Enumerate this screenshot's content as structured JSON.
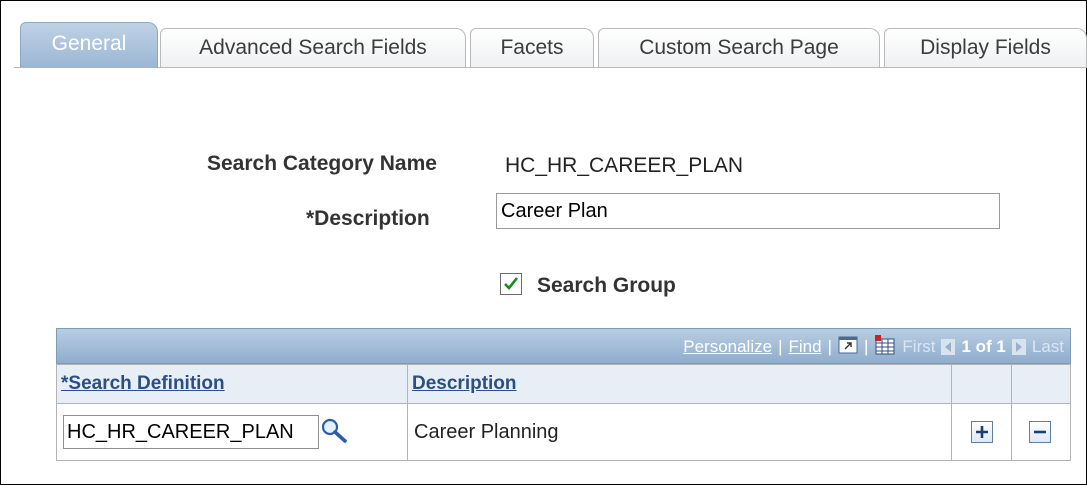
{
  "tabs": [
    {
      "label": "General",
      "active": true
    },
    {
      "label": "Advanced Search Fields",
      "active": false
    },
    {
      "label": "Facets",
      "active": false
    },
    {
      "label": "Custom Search Page",
      "active": false
    },
    {
      "label": "Display Fields",
      "active": false
    }
  ],
  "form": {
    "category_label": "Search Category Name",
    "category_value": "HC_HR_CAREER_PLAN",
    "description_label": "*Description",
    "description_value": "Career Plan",
    "search_group_label": "Search Group",
    "search_group_checked": true
  },
  "grid": {
    "personalize": "Personalize",
    "find": "Find",
    "separator": "|",
    "first": "First",
    "page_info": "1 of 1",
    "last": "Last",
    "columns": [
      "*Search Definition",
      "Description"
    ],
    "rows": [
      {
        "search_definition": "HC_HR_CAREER_PLAN",
        "description": "Career Planning"
      }
    ]
  },
  "icons": {
    "lookup": "magnifier-icon",
    "view_all": "zoom-window-icon",
    "download": "spreadsheet-icon",
    "add": "plus-icon",
    "delete": "minus-icon",
    "prev": "arrow-left-icon",
    "next": "arrow-right-icon"
  },
  "colors": {
    "active_tab": "#9bb6d3",
    "grid_header": "#8fadcd",
    "link": "#2a4e86"
  }
}
